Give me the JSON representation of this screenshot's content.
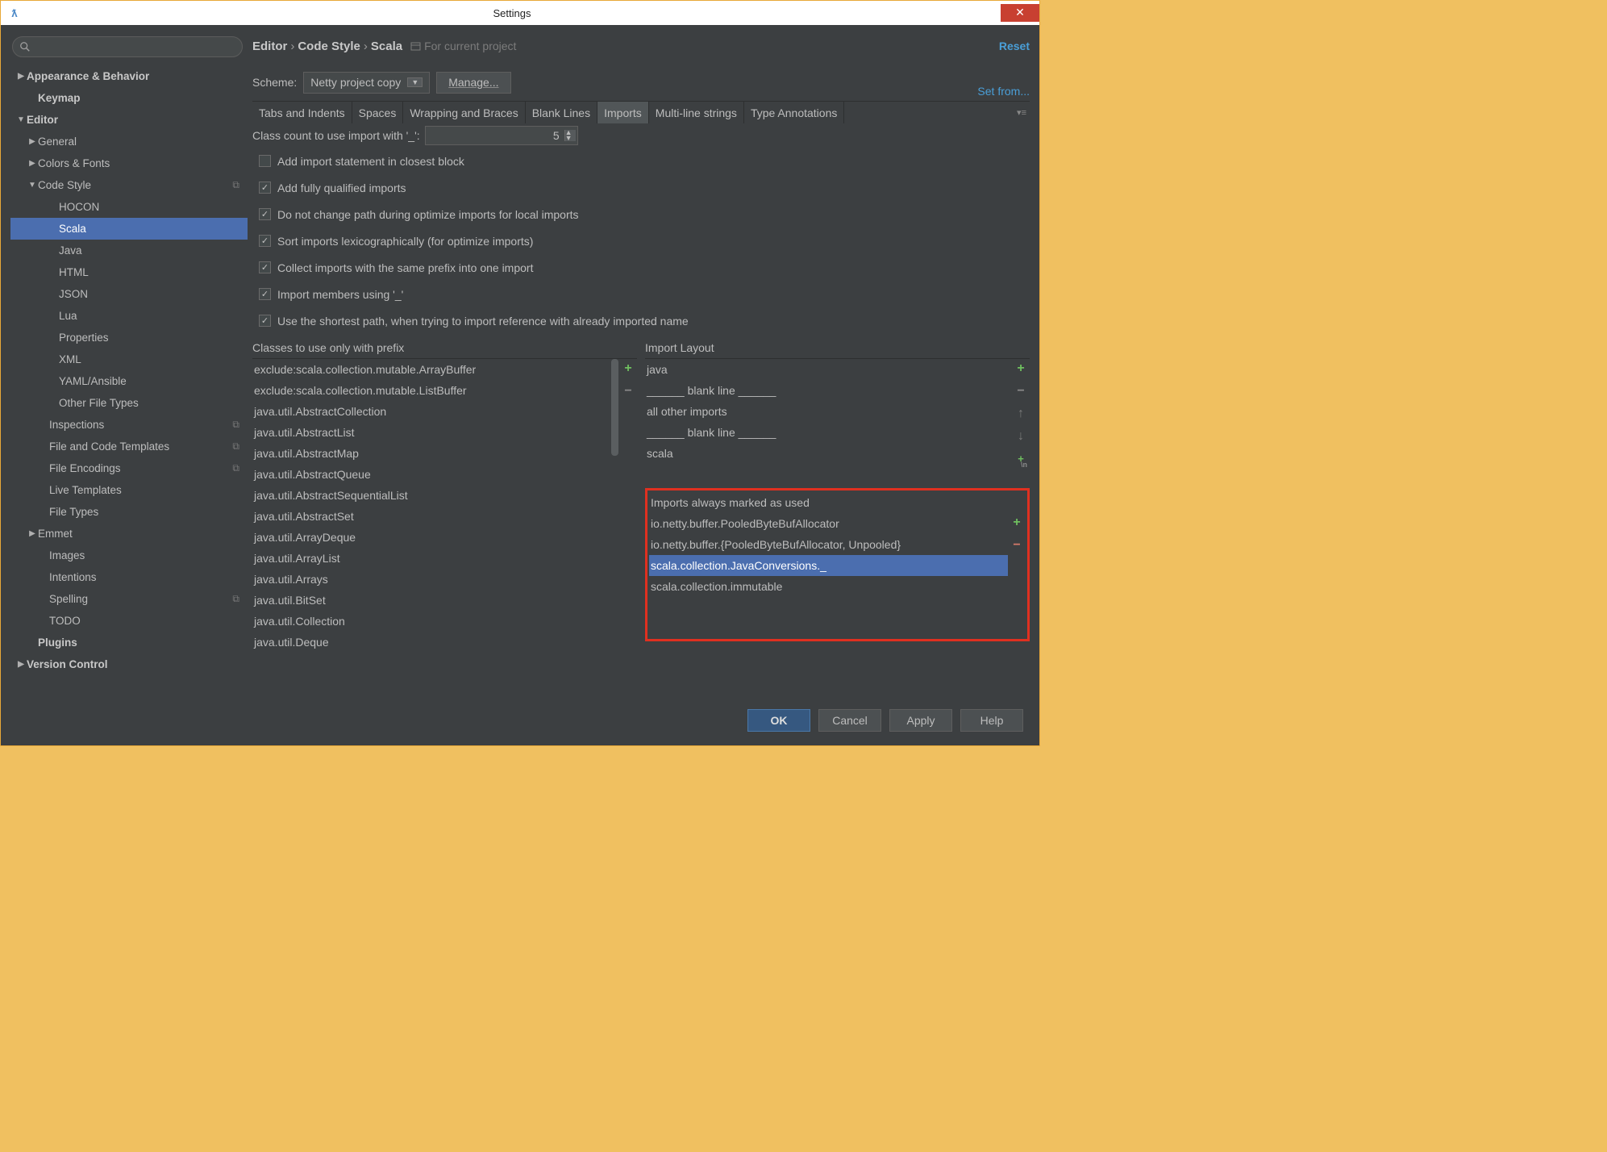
{
  "window": {
    "title": "Settings"
  },
  "sidebar": {
    "items": [
      {
        "label": "Appearance & Behavior",
        "bold": true,
        "arrow": "▶",
        "indent": 0
      },
      {
        "label": "Keymap",
        "bold": true,
        "arrow": "",
        "indent": 14
      },
      {
        "label": "Editor",
        "bold": true,
        "arrow": "▼",
        "indent": 0
      },
      {
        "label": "General",
        "arrow": "▶",
        "indent": 14
      },
      {
        "label": "Colors & Fonts",
        "arrow": "▶",
        "indent": 14
      },
      {
        "label": "Code Style",
        "arrow": "▼",
        "indent": 14,
        "copy": true
      },
      {
        "label": "HOCON",
        "indent": 40
      },
      {
        "label": "Scala",
        "indent": 40,
        "selected": true
      },
      {
        "label": "Java",
        "indent": 40
      },
      {
        "label": "HTML",
        "indent": 40
      },
      {
        "label": "JSON",
        "indent": 40
      },
      {
        "label": "Lua",
        "indent": 40
      },
      {
        "label": "Properties",
        "indent": 40
      },
      {
        "label": "XML",
        "indent": 40
      },
      {
        "label": "YAML/Ansible",
        "indent": 40
      },
      {
        "label": "Other File Types",
        "indent": 40
      },
      {
        "label": "Inspections",
        "indent": 28,
        "copy": true
      },
      {
        "label": "File and Code Templates",
        "indent": 28,
        "copy": true
      },
      {
        "label": "File Encodings",
        "indent": 28,
        "copy": true
      },
      {
        "label": "Live Templates",
        "indent": 28
      },
      {
        "label": "File Types",
        "indent": 28
      },
      {
        "label": "Emmet",
        "arrow": "▶",
        "indent": 14
      },
      {
        "label": "Images",
        "indent": 28
      },
      {
        "label": "Intentions",
        "indent": 28
      },
      {
        "label": "Spelling",
        "indent": 28,
        "copy": true
      },
      {
        "label": "TODO",
        "indent": 28
      },
      {
        "label": "Plugins",
        "bold": true,
        "indent": 14
      },
      {
        "label": "Version Control",
        "bold": true,
        "arrow": "▶",
        "indent": 0
      }
    ]
  },
  "breadcrumb": {
    "p1": "Editor",
    "p2": "Code Style",
    "p3": "Scala",
    "proj": "For current project"
  },
  "links": {
    "reset": "Reset",
    "setfrom": "Set from..."
  },
  "scheme": {
    "label": "Scheme:",
    "value": "Netty project copy",
    "manage": "Manage..."
  },
  "tabs": [
    "Tabs and Indents",
    "Spaces",
    "Wrapping and Braces",
    "Blank Lines",
    "Imports",
    "Multi-line strings",
    "Type Annotations"
  ],
  "tabs_active": 4,
  "classcount": {
    "label": "Class count to use import with '_':",
    "value": "5"
  },
  "checks": [
    {
      "label": "Add import statement in closest block",
      "checked": false
    },
    {
      "label": "Add fully qualified imports",
      "checked": true
    },
    {
      "label": "Do not change path during optimize imports for local imports",
      "checked": true
    },
    {
      "label": "Sort imports lexicographically (for optimize imports)",
      "checked": true
    },
    {
      "label": "Collect imports with the same prefix into one import",
      "checked": true
    },
    {
      "label": "Import members using '_'",
      "checked": true
    },
    {
      "label": "Use the shortest path, when trying to import reference with already imported name",
      "checked": true
    }
  ],
  "prefix_title": "Classes to use only with prefix",
  "prefix_list": [
    "exclude:scala.collection.mutable.ArrayBuffer",
    "exclude:scala.collection.mutable.ListBuffer",
    "java.util.AbstractCollection",
    "java.util.AbstractList",
    "java.util.AbstractMap",
    "java.util.AbstractQueue",
    "java.util.AbstractSequentialList",
    "java.util.AbstractSet",
    "java.util.ArrayDeque",
    "java.util.ArrayList",
    "java.util.Arrays",
    "java.util.BitSet",
    "java.util.Collection",
    "java.util.Deque"
  ],
  "layout_title": "Import Layout",
  "layout_list": [
    "java",
    "______ blank line ______",
    "all other imports",
    "______ blank line ______",
    "scala"
  ],
  "used_title": "Imports always marked as used",
  "used_list": [
    {
      "label": "io.netty.buffer.PooledByteBufAllocator"
    },
    {
      "label": "io.netty.buffer.{PooledByteBufAllocator, Unpooled}"
    },
    {
      "label": "scala.collection.JavaConversions._",
      "selected": true
    },
    {
      "label": "scala.collection.immutable"
    }
  ],
  "footer": {
    "ok": "OK",
    "cancel": "Cancel",
    "apply": "Apply",
    "help": "Help"
  }
}
